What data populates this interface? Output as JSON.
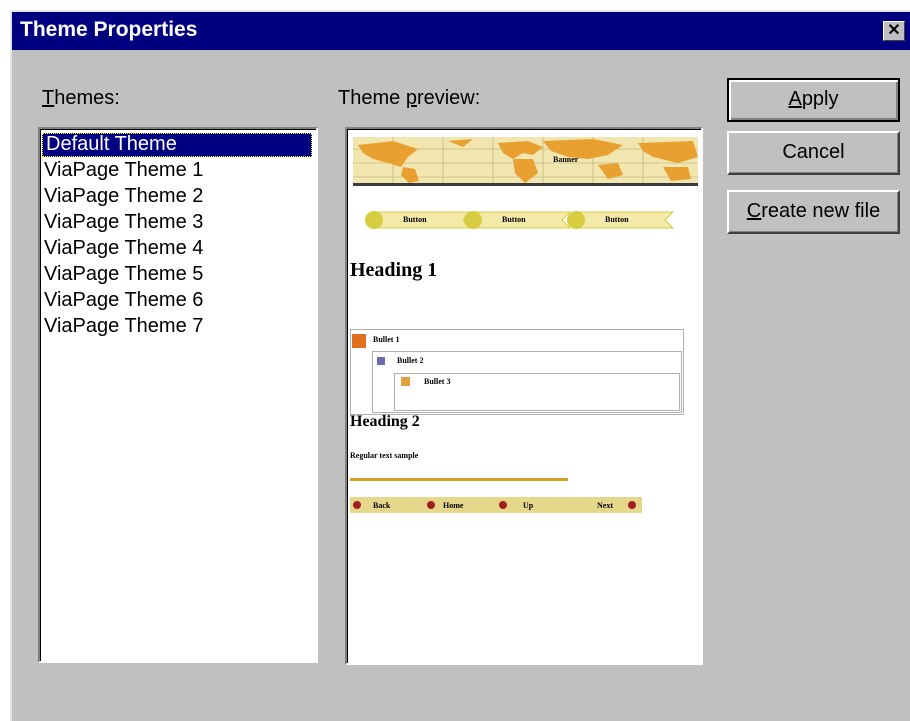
{
  "window": {
    "title": "Theme Properties",
    "close_glyph": "✕"
  },
  "labels": {
    "themes_accel": "T",
    "themes_rest": "hemes:",
    "preview_pre": "Theme ",
    "preview_accel": "p",
    "preview_rest": "review:"
  },
  "themes": {
    "items": [
      "Default Theme",
      "ViaPage Theme 1",
      "ViaPage Theme 2",
      "ViaPage Theme 3",
      "ViaPage Theme 4",
      "ViaPage Theme 5",
      "ViaPage Theme 6",
      "ViaPage Theme 7"
    ],
    "selected": "Default Theme"
  },
  "buttons": {
    "apply_accel": "A",
    "apply_rest": "pply",
    "cancel": "Cancel",
    "create_accel": "C",
    "create_rest": "reate new file"
  },
  "preview": {
    "banner_text": "Banner",
    "nav": [
      "Button",
      "Button",
      "Button"
    ],
    "heading1": "Heading 1",
    "bullets": [
      "Bullet 1",
      "Bullet 2",
      "Bullet 3"
    ],
    "heading2": "Heading 2",
    "regular_text": "Regular text sample",
    "footer_nav": [
      "Back",
      "Home",
      "Up",
      "Next"
    ],
    "colors": {
      "banner_bg": "#f2e6b0",
      "map": "#e8a030",
      "nav_pill": "#f3e9a8",
      "nav_circle": "#d8cc40",
      "bullet1": "#e07020",
      "bullet2": "#6a6ab0",
      "bullet3": "#e0a040",
      "rule": "#d4a020",
      "footer_bg": "#e6d88a",
      "footer_dot": "#a02020"
    }
  }
}
